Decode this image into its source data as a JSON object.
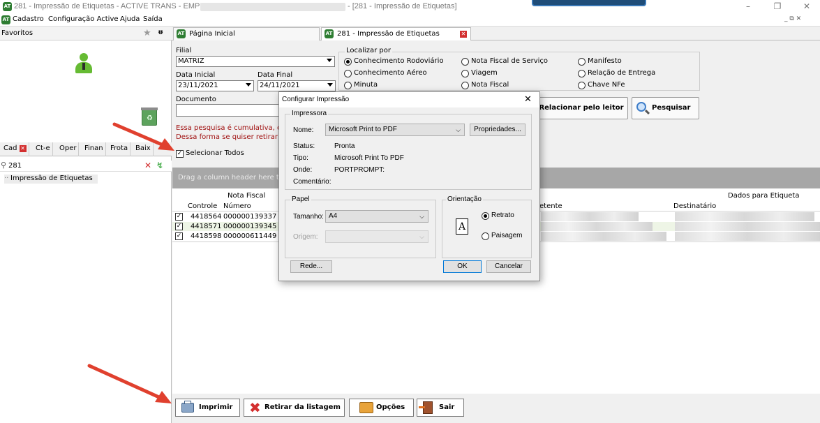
{
  "window": {
    "title": "281 - Impressão de Etiquetas - ACTIVE TRANS - EMPRESA:",
    "title_suffix": "- [281 - Impressão de Etiquetas]",
    "app_icon": "AT"
  },
  "menu": [
    "Cadastro",
    "Configuração Active",
    "Ajuda",
    "Saída"
  ],
  "favorites": {
    "label": "Favoritos"
  },
  "left_tabs": [
    "Cad",
    "Ct-e",
    "Oper",
    "Finan",
    "Frota",
    "Baix"
  ],
  "search": {
    "value": "281"
  },
  "tree": {
    "item": "Impressão de Etiquetas"
  },
  "doc_tabs": [
    {
      "label": "Página Inicial"
    },
    {
      "label": "281 - Impressão de Etiquetas"
    }
  ],
  "form": {
    "filial_label": "Filial",
    "filial_value": "MATRIZ",
    "data_inicial_label": "Data Inicial",
    "data_inicial_value": "23/11/2021",
    "data_final_label": "Data Final",
    "data_final_value": "24/11/2021",
    "documento_label": "Documento",
    "note_line1": "Essa pesquisa é cumulativa, o",
    "note_line2": "Dessa forma se quiser retirar",
    "select_all_label": "Selecionar Todos",
    "localizar_label": "Localizar por",
    "radios": [
      [
        "Conhecimento Rodoviário",
        "Nota Fiscal de Serviço",
        "Manifesto"
      ],
      [
        "Conhecimento Aéreo",
        "Viagem",
        "Relação de Entrega"
      ],
      [
        "Minuta",
        "Nota Fiscal",
        "Chave NFe"
      ]
    ],
    "selected_radio": "Conhecimento Rodoviário",
    "relacionar_label": "Relacionar pelo leitor",
    "pesquisar_label": "Pesquisar"
  },
  "grid": {
    "group_hint": "Drag a column header here t",
    "nota_fiscal_header": "Nota Fiscal",
    "dados_header": "Dados para Etiqueta",
    "col_controle": "Controle",
    "col_numero": "Número",
    "col_remetente": "etente",
    "col_destinatario": "Destinatário",
    "rows": [
      {
        "controle": "4418564",
        "numero": "000000139337",
        "checked": true
      },
      {
        "controle": "4418571",
        "numero": "000000139345",
        "checked": true
      },
      {
        "controle": "4418598",
        "numero": "000000611449",
        "checked": true
      }
    ]
  },
  "bottom_buttons": {
    "imprimir": "Imprimir",
    "retirar": "Retirar da listagem",
    "opcoes": "Opções",
    "sair": "Sair"
  },
  "dialog": {
    "title": "Configurar Impressão",
    "impressora_label": "Impressora",
    "nome_label": "Nome:",
    "nome_value": "Microsoft Print to PDF",
    "propriedades": "Propriedades...",
    "status_label": "Status:",
    "status_value": "Pronta",
    "tipo_label": "Tipo:",
    "tipo_value": "Microsoft Print To PDF",
    "onde_label": "Onde:",
    "onde_value": "PORTPROMPT:",
    "comentario_label": "Comentário:",
    "papel_label": "Papel",
    "tamanho_label": "Tamanho:",
    "tamanho_value": "A4",
    "origem_label": "Origem:",
    "orientacao_label": "Orientação",
    "retrato": "Retrato",
    "paisagem": "Paisagem",
    "orientation_selected": "Retrato",
    "orientation_icon": "A",
    "rede": "Rede...",
    "ok": "OK",
    "cancelar": "Cancelar"
  },
  "colors": {
    "annotation_arrow": "#e0402e",
    "note_text": "#a01010",
    "person_icon": "#66bb33",
    "group_bar": "#a7a7a7"
  }
}
